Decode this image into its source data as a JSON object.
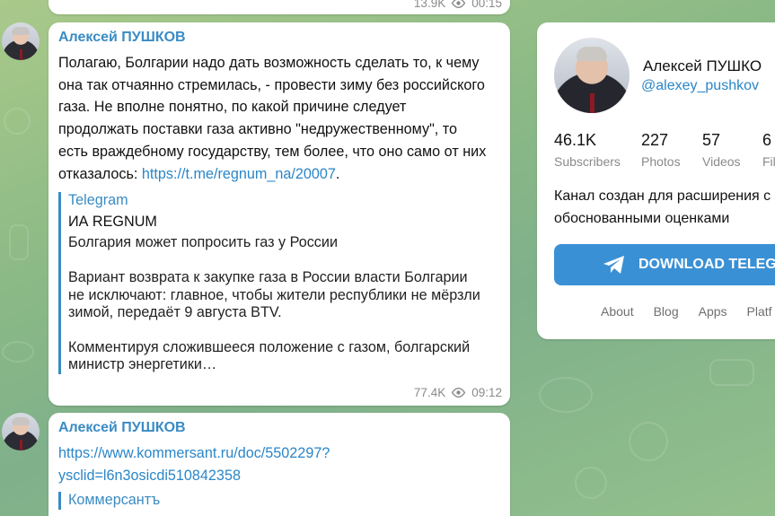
{
  "top_message": {
    "views": "13.9K",
    "time": "00:15"
  },
  "main_message": {
    "author": "Алексей ПУШКОВ",
    "text_lines": [
      "Полагаю, Болгарии надо дать возможность сделать то, к чему",
      "она так отчаянно стремилась, - провести зиму без российского",
      "газа. Не вполне понятно, по какой причине следует",
      "продолжать поставки газа активно \"недружественному\", то",
      "есть враждебному государству, тем более, что оно само от них"
    ],
    "last_line_prefix": "отказалось: ",
    "link": "https://t.me/regnum_na/20007",
    "last_line_suffix": ".",
    "preview": {
      "site": "Telegram",
      "title": "ИА REGNUM",
      "subtitle": "Болгария может попросить газ у России",
      "para1_lines": [
        "Вариант возврата к закупке газа в России власти Болгарии",
        "не исключают: главное, чтобы жители республики не мёрзли",
        "зимой, передаёт 9 августа BTV."
      ],
      "para2_lines": [
        "Комментируя сложившееся положение с газом, болгарский",
        "министр энергетики…"
      ]
    },
    "views": "77.4K",
    "time": "09:12"
  },
  "bottom_message": {
    "author": "Алексей ПУШКОВ",
    "link_line1": "https://www.kommersant.ru/doc/5502297?",
    "link_line2": "ysclid=l6n3osicdi510842358",
    "preview_site": "Коммерсантъ"
  },
  "channel_card": {
    "name": "Алексей ПУШКО",
    "handle": "@alexey_pushkov",
    "stats": [
      {
        "num": "46.1K",
        "label": "Subscribers"
      },
      {
        "num": "227",
        "label": "Photos"
      },
      {
        "num": "57",
        "label": "Videos"
      },
      {
        "num": "6",
        "label": "Fil"
      }
    ],
    "description_lines": [
      "Канал создан для расширения с",
      "обоснованными оценками"
    ],
    "download_label": "DOWNLOAD TELEGR",
    "footer_links": [
      "About",
      "Blog",
      "Apps",
      "Platf"
    ]
  },
  "colors": {
    "accent": "#3a8bc4",
    "link": "#2a86c8",
    "button": "#3a90d5",
    "meta_gray": "#8b8b8b"
  },
  "icons": [
    "eye-icon",
    "telegram-plane-icon",
    "avatar"
  ]
}
